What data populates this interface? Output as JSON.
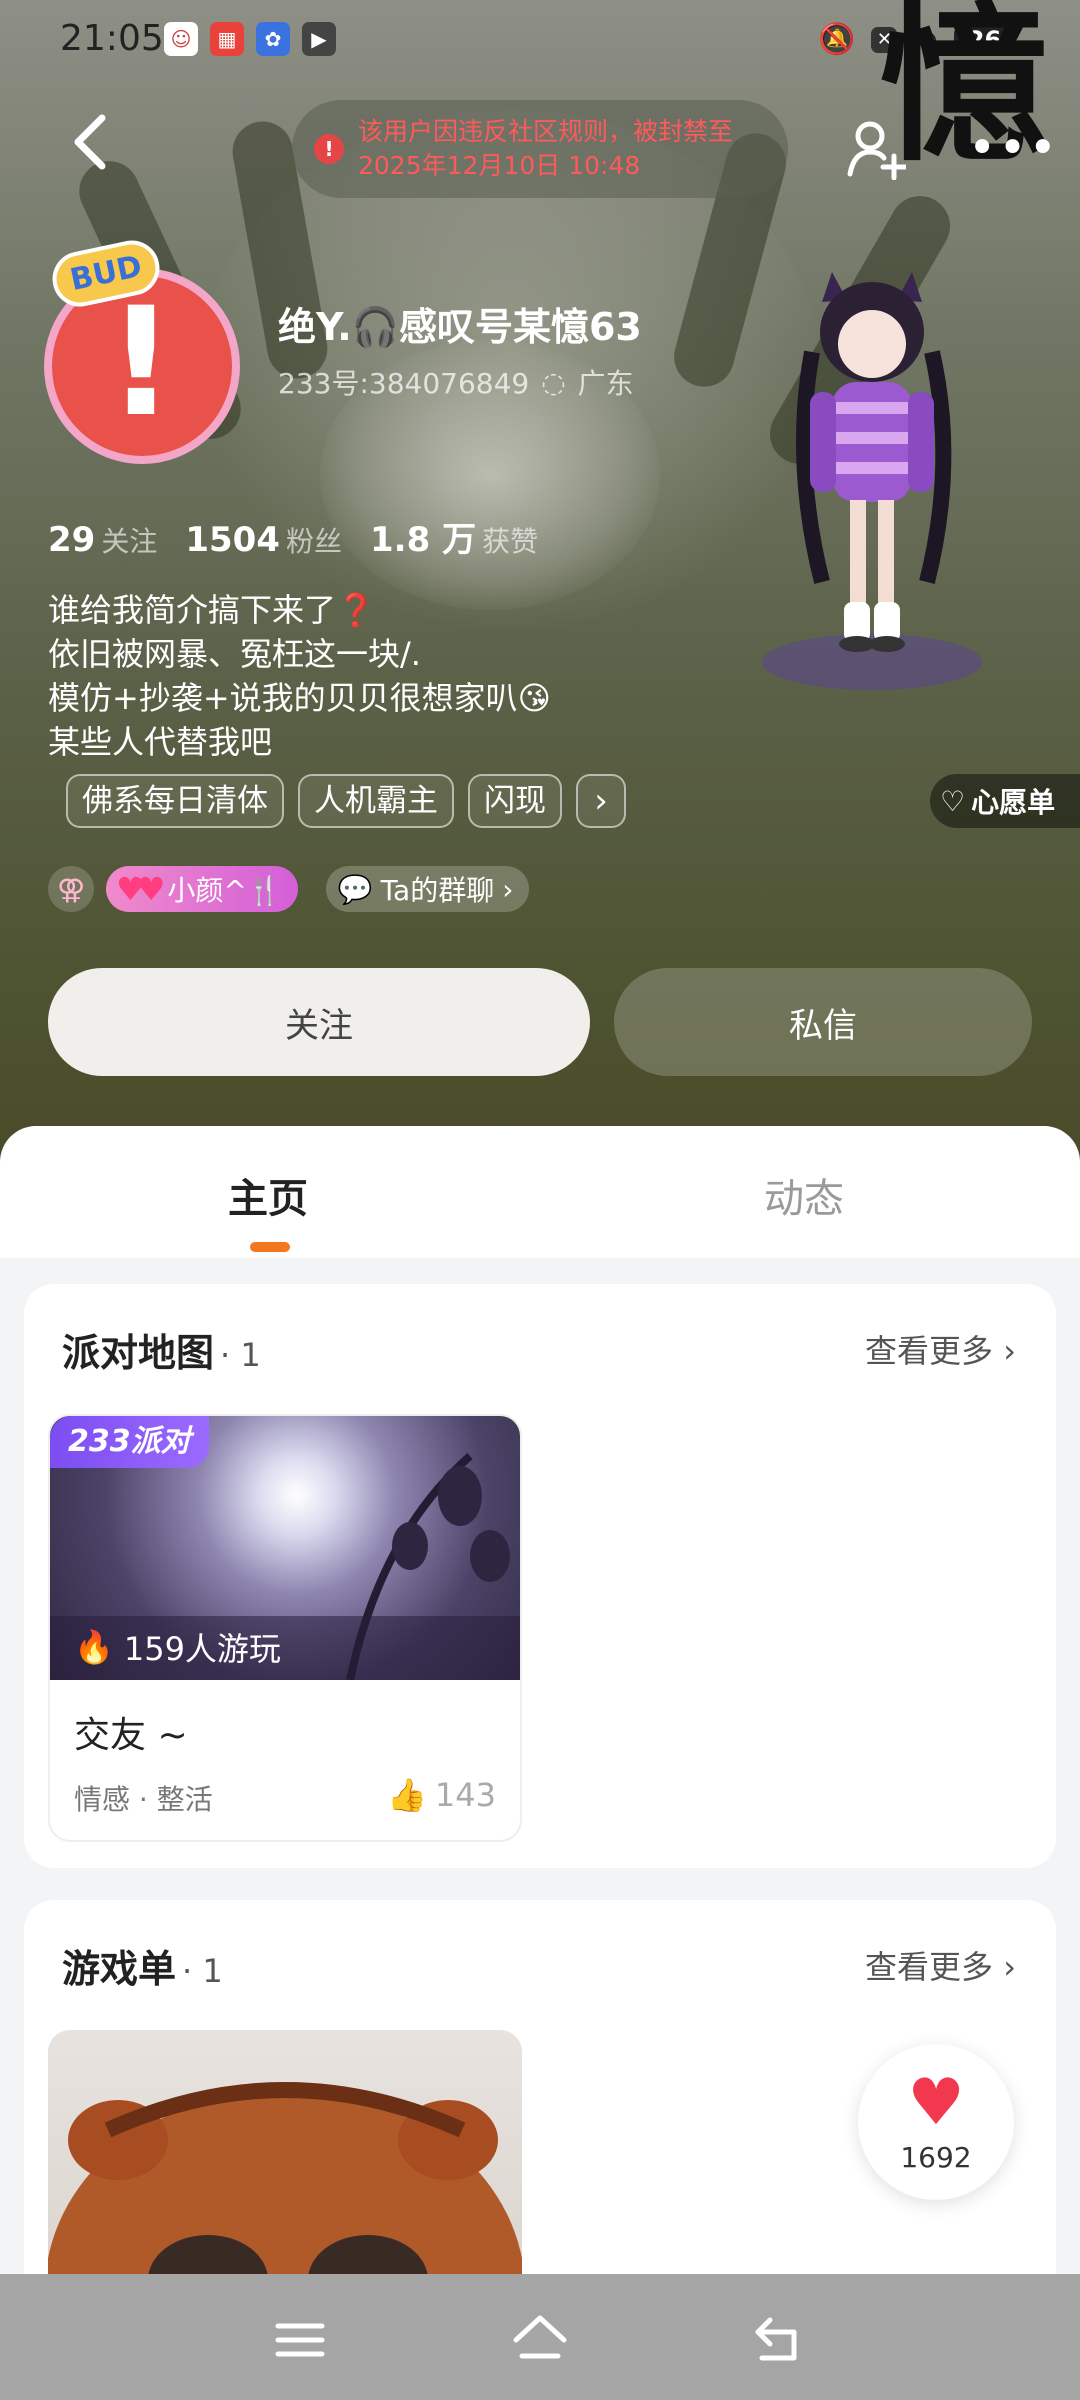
{
  "status_bar": {
    "time": "21:05",
    "battery": "26",
    "icons": [
      "avatar-app-icon",
      "game-app-icon",
      "paw-app-icon",
      "video-app-icon",
      "mute-icon",
      "close-icon",
      "wifi-icon"
    ]
  },
  "overlay_glyph": "憶",
  "header": {
    "ban_notice": "该用户因违反社区规则，被封禁至2025年12月10日 10:48",
    "ban_notice_line1": "该用户因违反社区规则，被封禁至",
    "ban_notice_line2": "2025年12月10日 10:48",
    "ban_icon": "!"
  },
  "profile": {
    "nickname": "绝Y.🎧感叹号某憶63",
    "uid": "233号:384076849",
    "location": "广东",
    "badge": "BUD",
    "stats": [
      {
        "value": "29",
        "label": "关注"
      },
      {
        "value": "1504",
        "label": "粉丝"
      },
      {
        "value": "1.8 万",
        "label": "获赞"
      }
    ],
    "bio_lines": [
      "谁给我简介搞下来了❓",
      "依旧被网暴、冤枉这一块/.",
      "模仿+抄袭+说我的贝贝很想家叭😘",
      "某些人代替我吧"
    ],
    "tags": [
      "佛系每日清体",
      "人机霸主",
      "闪现"
    ],
    "tag_more": "›",
    "wishlist": "心愿单",
    "gender_symbol": "⚢",
    "couple_name": "小颜^🍴",
    "group_chat": "Ta的群聊",
    "follow_button": "关注",
    "message_button": "私信"
  },
  "tabs": {
    "home": "主页",
    "feed": "动态"
  },
  "party_map": {
    "title": "派对地图",
    "count": "· 1",
    "more": "查看更多 ›",
    "item": {
      "tag": "233派对",
      "players": "159人游玩",
      "name": "交友 ~",
      "categories": "情感 · 整活",
      "likes": "143"
    }
  },
  "game_list": {
    "title": "游戏单",
    "count": "· 1",
    "more": "查看更多 ›"
  },
  "floating_like": {
    "count": "1692"
  },
  "colors": {
    "accent": "#f4761f",
    "ban_red": "#ff5a5a",
    "party_purple": "#7c4df1",
    "like_red": "#f2384e"
  }
}
